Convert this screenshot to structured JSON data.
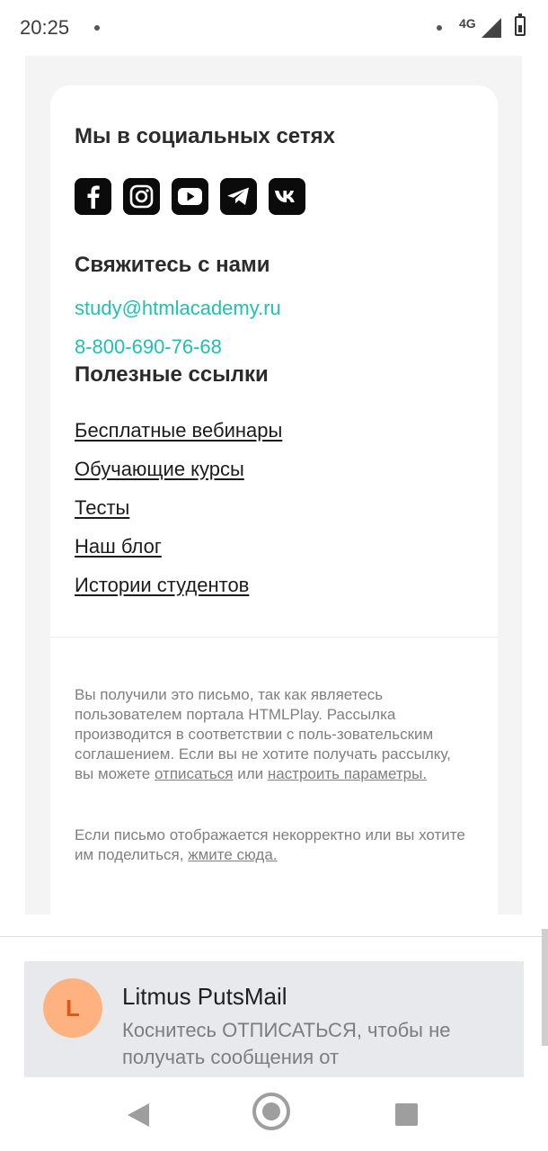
{
  "status_bar": {
    "time": "20:25",
    "network": "4G"
  },
  "email": {
    "social": {
      "title": "Мы в социальных сетях",
      "icons": [
        "facebook-icon",
        "instagram-icon",
        "youtube-icon",
        "telegram-icon",
        "vk-icon"
      ]
    },
    "contact": {
      "title": "Свяжитесь с нами",
      "email": "study@htmlacademy.ru",
      "phone": "8-800-690-76-68"
    },
    "useful": {
      "title": "Полезные ссылки",
      "links": [
        "Бесплатные вебинары",
        "Обучающие курсы",
        "Тесты",
        "Наш блог",
        "Истории студентов"
      ]
    },
    "footer": {
      "p1_text": "Вы получили это письмо, так как являетесь пользователем портала HTMLPlay. Рассылка производится в соответствии с поль-зовательским соглашением. Если вы не хотите получать рассылку, вы можете ",
      "unsubscribe": "отписаться",
      "or": " или ",
      "settings": "настроить параметры.",
      "p2_text": "Если письмо отображается некорректно или вы хотите им поделиться, ",
      "here": "жмите сюда."
    },
    "link_color": "#1fc1b0"
  },
  "notification": {
    "avatar_letter": "L",
    "title": "Litmus PutsMail",
    "body": "Коснитесь ОТПИСАТЬСЯ, чтобы не получать сообщения от"
  },
  "nav": {
    "icons": [
      "back-icon",
      "home-icon",
      "recent-apps-icon"
    ]
  }
}
